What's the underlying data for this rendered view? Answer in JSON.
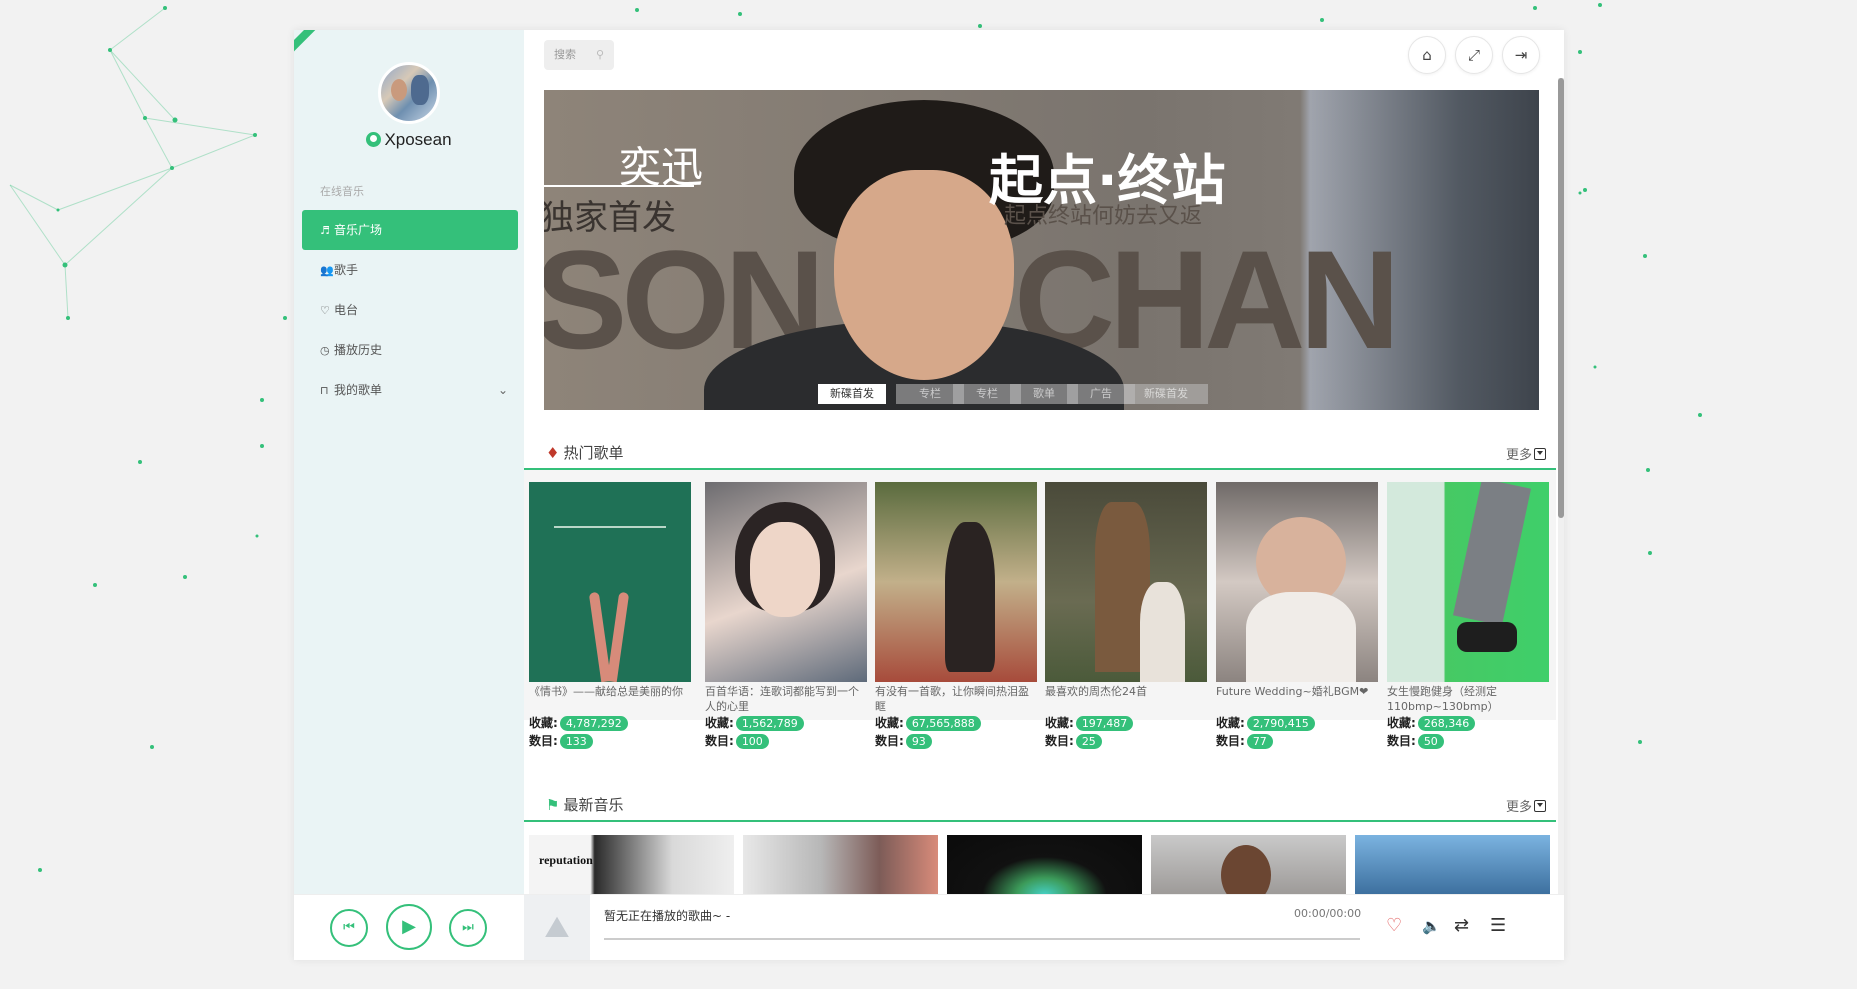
{
  "user": {
    "name": "Xposean"
  },
  "menu": {
    "section_label": "在线音乐",
    "items": [
      {
        "label": "音乐广场",
        "icon": "music-icon",
        "active": true
      },
      {
        "label": "歌手",
        "icon": "users-icon"
      },
      {
        "label": "电台",
        "icon": "heartbeat-icon"
      },
      {
        "label": "播放历史",
        "icon": "clock-icon"
      },
      {
        "label": "我的歌单",
        "icon": "lock-icon",
        "has_dropdown": true
      }
    ]
  },
  "topbar": {
    "search_placeholder": "搜索",
    "buttons": [
      "home-icon",
      "expand-icon",
      "logout-icon"
    ]
  },
  "banner": {
    "brand": "奕迅",
    "exclusive": "独家首发",
    "album": "起点·终站",
    "album_sub": "起点终站何妨去又返",
    "artist_left": "SON",
    "artist_right": "CHAN",
    "tabs": [
      "新碟首发",
      "专栏",
      "专栏",
      "歌单",
      "广告",
      "新碟首发"
    ]
  },
  "hot": {
    "title": "热门歌单",
    "more": "更多",
    "collect_label": "收藏:",
    "count_label": "数目:",
    "playlists": [
      {
        "title": "《情书》——献给总是美丽的你",
        "collect": "4,787,292",
        "count": "133"
      },
      {
        "title": "百首华语：连歌词都能写到一个人的心里",
        "collect": "1,562,789",
        "count": "100"
      },
      {
        "title": "有没有一首歌，让你瞬间热泪盈眶",
        "collect": "67,565,888",
        "count": "93"
      },
      {
        "title": "最喜欢的周杰伦24首",
        "collect": "197,487",
        "count": "25"
      },
      {
        "title": "Future Wedding~婚礼BGM❤",
        "collect": "2,790,415",
        "count": "77"
      },
      {
        "title": "女生慢跑健身（经测定110bmp~130bmp）",
        "collect": "268,346",
        "count": "50"
      }
    ]
  },
  "latest": {
    "title": "最新音乐",
    "more": "更多",
    "first_cover_text": "reputation"
  },
  "player": {
    "now_playing": "暂无正在播放的歌曲~ -",
    "time": "00:00/00:00"
  },
  "colors": {
    "accent": "#34c07a"
  }
}
